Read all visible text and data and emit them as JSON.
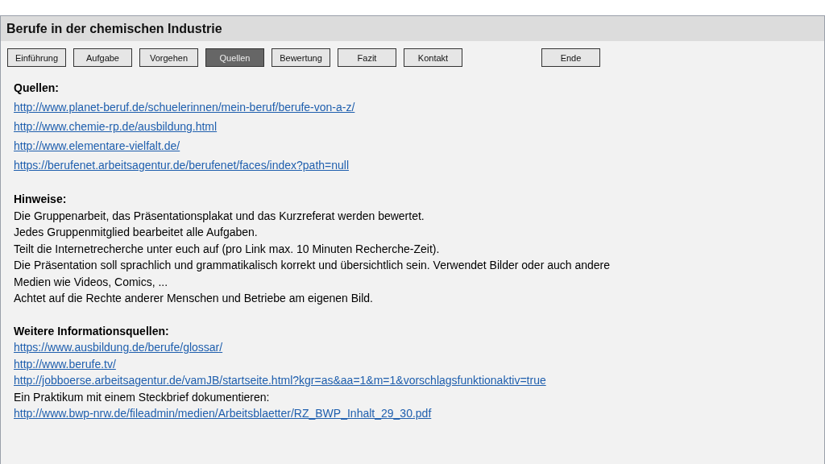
{
  "title": "Berufe in der chemischen Industrie",
  "nav": [
    {
      "label": "Einführung",
      "selected": false
    },
    {
      "label": "Aufgabe",
      "selected": false
    },
    {
      "label": "Vorgehen",
      "selected": false
    },
    {
      "label": "Quellen",
      "selected": true
    },
    {
      "label": "Bewertung",
      "selected": false
    },
    {
      "label": "Fazit",
      "selected": false
    },
    {
      "label": "Kontakt",
      "selected": false
    }
  ],
  "end_button": "Ende",
  "sections": [
    {
      "heading": "Quellen:",
      "lines": [
        {
          "kind": "link",
          "text": "http://www.planet-beruf.de/schuelerinnen/mein-beruf/berufe-von-a-z/"
        },
        {
          "kind": "link",
          "text": "http://www.chemie-rp.de/ausbildung.html"
        },
        {
          "kind": "link",
          "text": "http://www.elementare-vielfalt.de/"
        },
        {
          "kind": "link",
          "text": "https://berufenet.arbeitsagentur.de/berufenet/faces/index?path=null"
        }
      ]
    },
    {
      "heading": "Hinweise:",
      "lines": [
        {
          "kind": "text",
          "text": "Die Gruppenarbeit, das Präsentationsplakat und das Kurzreferat werden bewertet."
        },
        {
          "kind": "text",
          "text": "Jedes Gruppenmitglied bearbeitet alle Aufgaben."
        },
        {
          "kind": "text",
          "text": "Teilt die Internetrecherche unter euch auf (pro Link max. 10 Minuten Recherche-Zeit)."
        },
        {
          "kind": "text",
          "text": "Die Präsentation soll sprachlich und grammatikalisch korrekt und übersichtlich sein. Verwendet Bilder oder auch andere Medien wie Videos, Comics, ..."
        },
        {
          "kind": "text",
          "text": "Achtet auf die Rechte anderer Menschen und Betriebe am eigenen Bild."
        }
      ]
    },
    {
      "heading": "Weitere Informationsquellen:",
      "lines": [
        {
          "kind": "link",
          "text": "https://www.ausbildung.de/berufe/glossar/"
        },
        {
          "kind": "link",
          "text": "http://www.berufe.tv/"
        },
        {
          "kind": "link",
          "text": "http://jobboerse.arbeitsagentur.de/vamJB/startseite.html?kgr=as&aa=1&m=1&vorschlagsfunktionaktiv=true"
        },
        {
          "kind": "text",
          "text": "Ein Praktikum mit einem Steckbrief dokumentieren:"
        },
        {
          "kind": "link",
          "text": "http://www.bwp-nrw.de/fileadmin/medien/Arbeitsblaetter/RZ_BWP_Inhalt_29_30.pdf"
        }
      ]
    }
  ]
}
